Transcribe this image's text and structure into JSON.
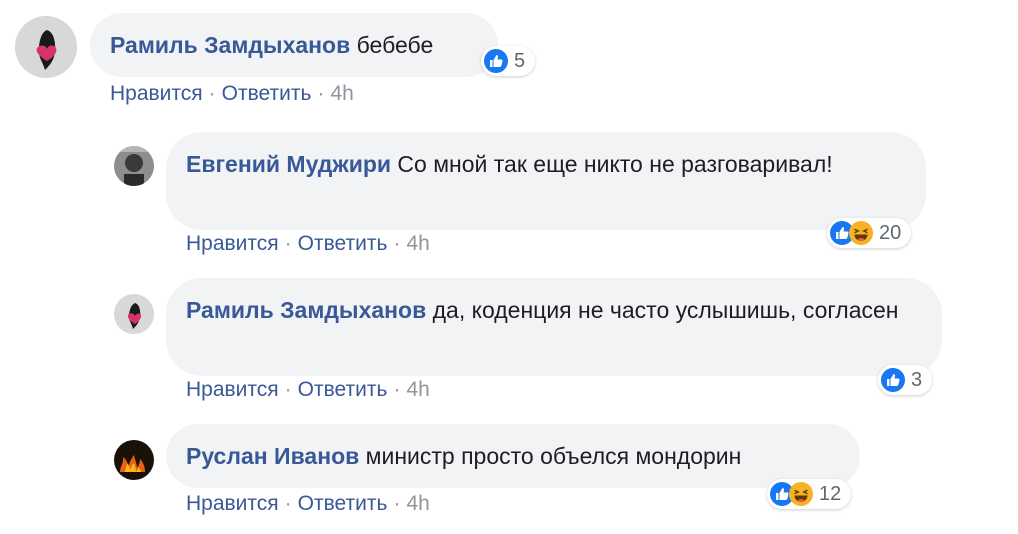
{
  "comments": [
    {
      "author": "Рамиль Замдыханов",
      "text": "бебебе",
      "actions": {
        "like": "Нравится",
        "reply": "Ответить",
        "time": "4h"
      },
      "reactions": {
        "icons": [
          "like-icon"
        ],
        "count": "5"
      }
    },
    {
      "author": "Евгений Муджири",
      "text": "Со мной так еще никто не разговаривал!",
      "actions": {
        "like": "Нравится",
        "reply": "Ответить",
        "time": "4h"
      },
      "reactions": {
        "icons": [
          "like-icon",
          "haha-icon"
        ],
        "count": "20"
      }
    },
    {
      "author": "Рамиль Замдыханов",
      "text": "да, коденция не часто услышишь, согласен",
      "actions": {
        "like": "Нравится",
        "reply": "Ответить",
        "time": "4h"
      },
      "reactions": {
        "icons": [
          "like-icon"
        ],
        "count": "3"
      }
    },
    {
      "author": "Руслан Иванов",
      "text": "министр просто объелся мондорин",
      "actions": {
        "like": "Нравится",
        "reply": "Ответить",
        "time": "4h"
      },
      "reactions": {
        "icons": [
          "like-icon",
          "haha-icon"
        ],
        "count": "12"
      }
    }
  ],
  "separator": "·",
  "colors": {
    "author": "#385898",
    "bubble": "#f2f3f5",
    "like": "#1877f2",
    "haha": "#f7b125",
    "meta": "#90949c"
  }
}
